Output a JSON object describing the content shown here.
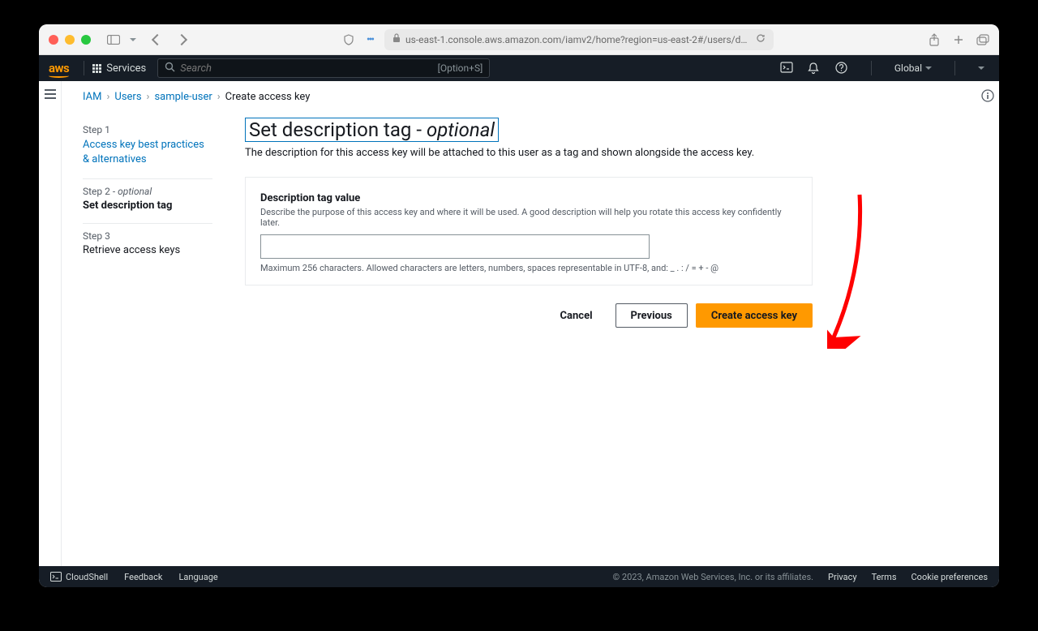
{
  "browser": {
    "url": "us-east-1.console.aws.amazon.com/iamv2/home?region=us-east-2#/users/details/sample-u"
  },
  "header": {
    "services": "Services",
    "search_placeholder": "Search",
    "search_hint": "[Option+S]",
    "region": "Global"
  },
  "breadcrumbs": {
    "items": [
      "IAM",
      "Users",
      "sample-user"
    ],
    "current": "Create access key"
  },
  "steps": {
    "s1_num": "Step 1",
    "s1_label": "Access key best practices & alternatives",
    "s2_num": "Step 2 - ",
    "s2_opt": "optional",
    "s2_label": "Set description tag",
    "s3_num": "Step 3",
    "s3_label": "Retrieve access keys"
  },
  "page": {
    "title_pre": "Set description tag - ",
    "title_opt": "optional",
    "subtitle": "The description for this access key will be attached to this user as a tag and shown alongside the access key."
  },
  "form": {
    "label": "Description tag value",
    "hint": "Describe the purpose of this access key and where it will be used. A good description will help you rotate this access key confidently later.",
    "value": "",
    "footer": "Maximum 256 characters. Allowed characters are letters, numbers, spaces representable in UTF-8, and: _ . : / = + - @"
  },
  "actions": {
    "cancel": "Cancel",
    "previous": "Previous",
    "create": "Create access key"
  },
  "footer": {
    "cloudshell": "CloudShell",
    "feedback": "Feedback",
    "language": "Language",
    "copyright": "© 2023, Amazon Web Services, Inc. or its affiliates.",
    "privacy": "Privacy",
    "terms": "Terms",
    "cookies": "Cookie preferences"
  }
}
